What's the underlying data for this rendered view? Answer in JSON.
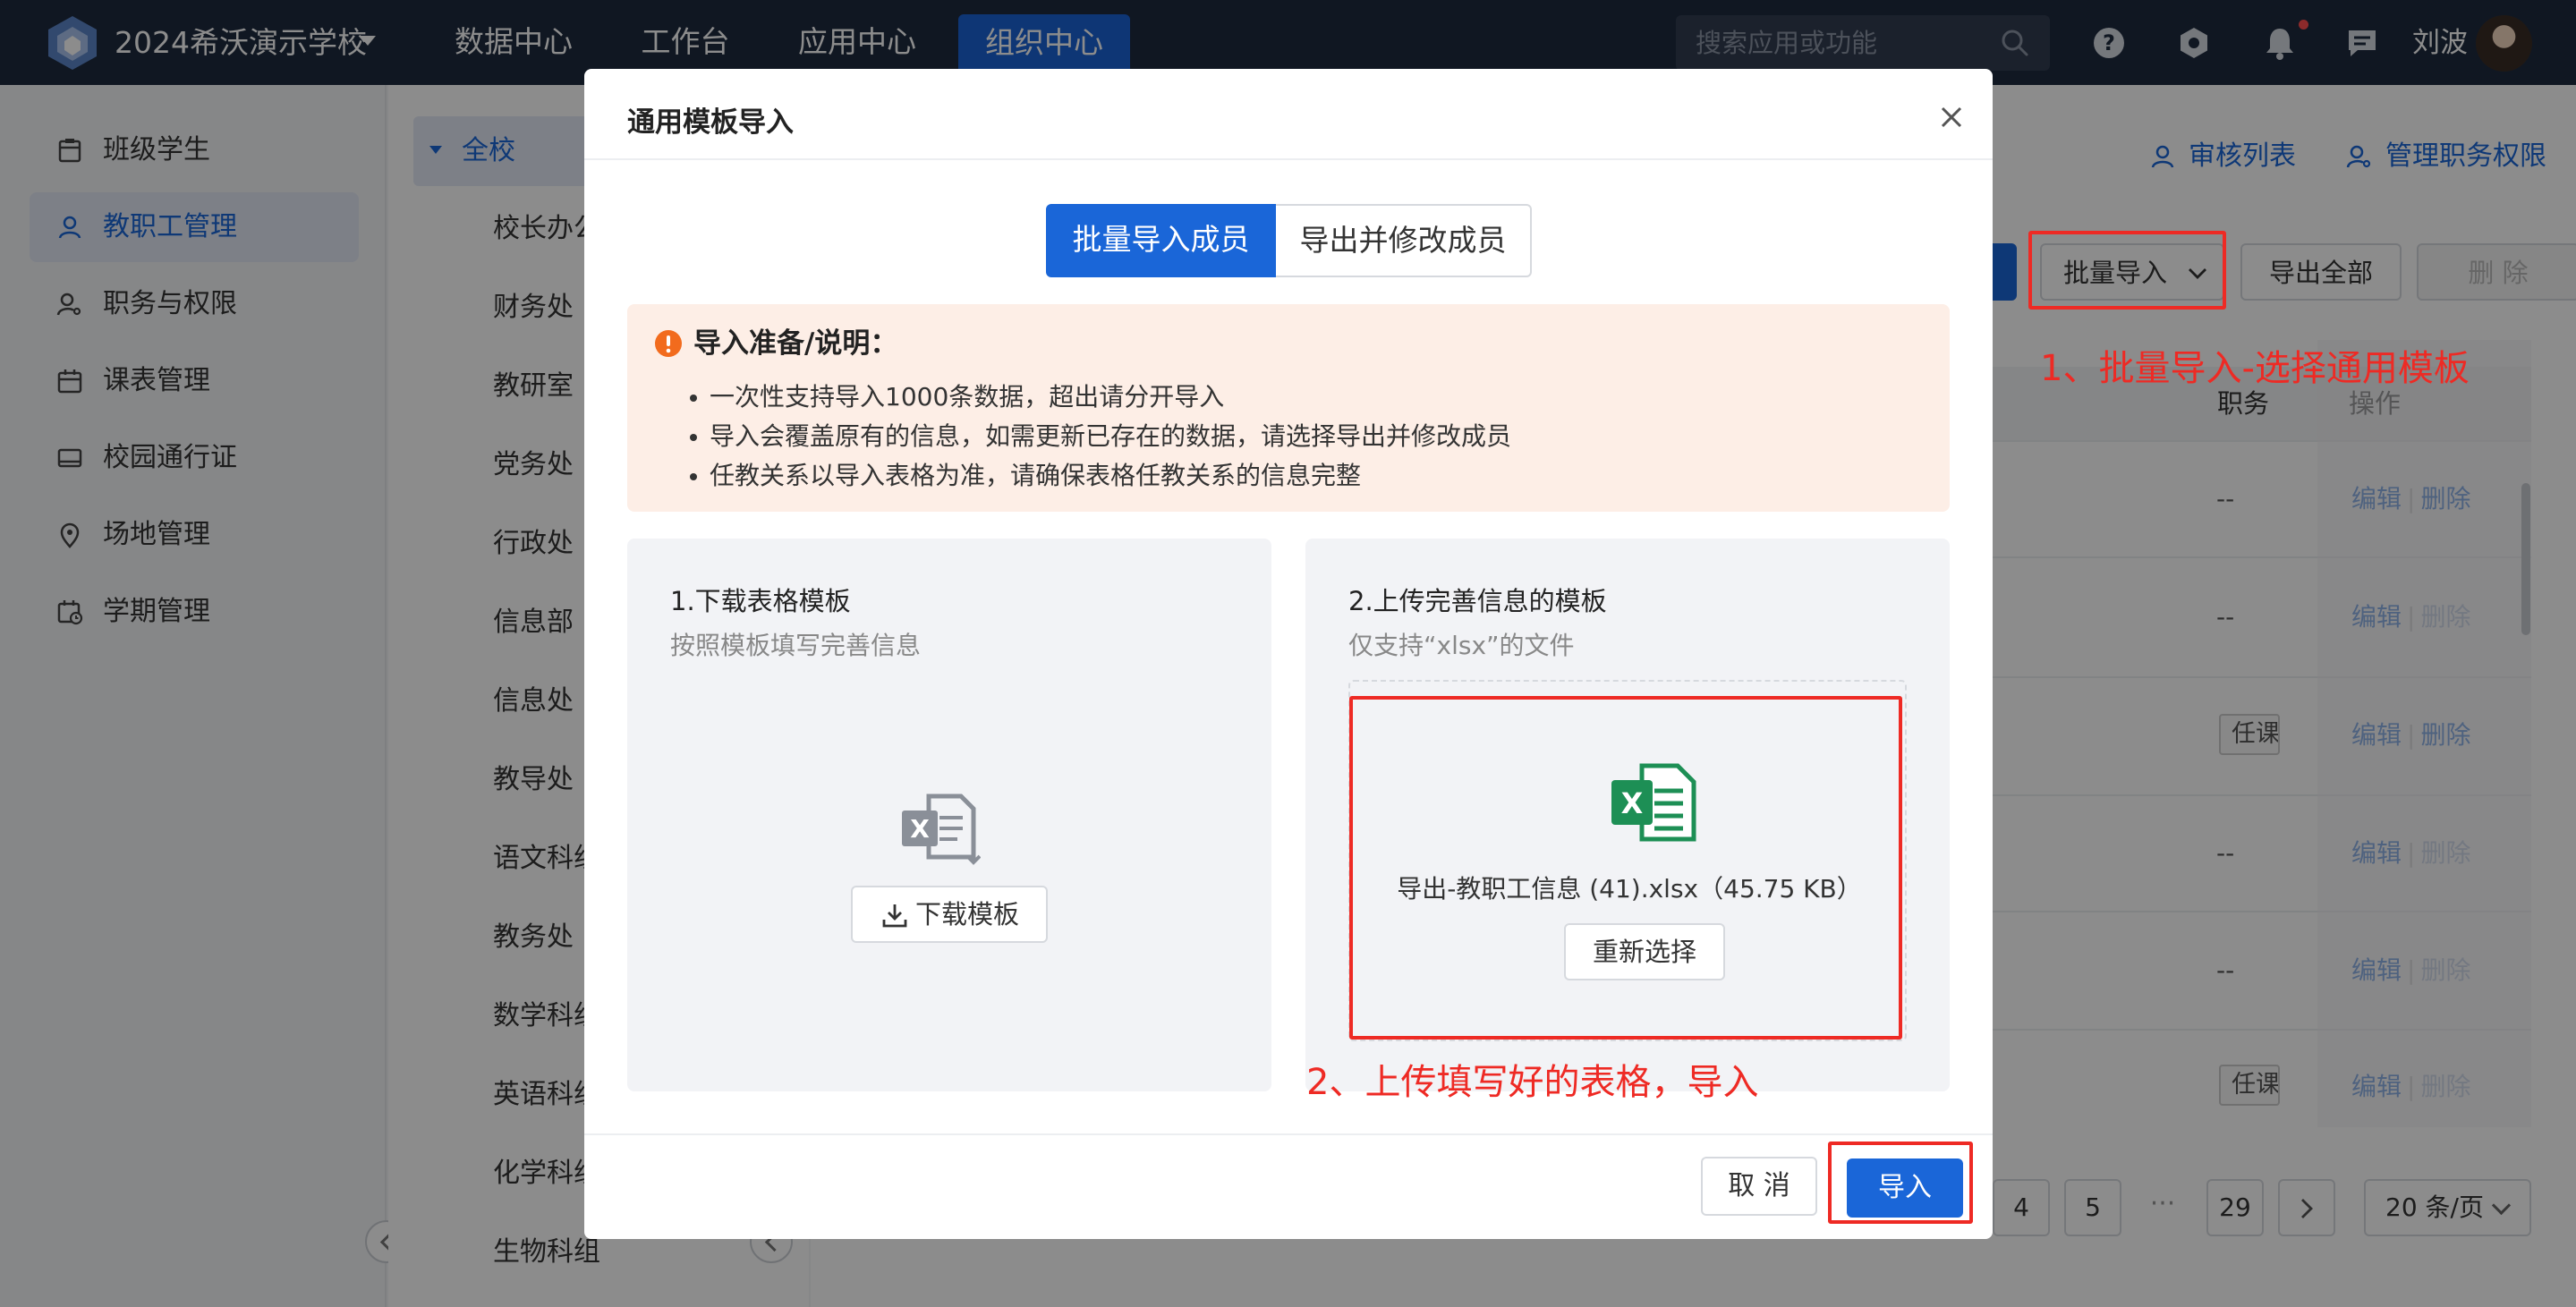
{
  "topbar": {
    "school_name": "2024希沃演示学校",
    "nav": [
      "数据中心",
      "工作台",
      "应用中心",
      "组织中心"
    ],
    "active_nav": "组织中心",
    "search_placeholder": "搜索应用或功能",
    "username": "刘波",
    "colors": {
      "bar": "#1e2a3f",
      "active": "#1b63d6"
    }
  },
  "sidebar": {
    "items": [
      {
        "label": "班级学生",
        "icon": "clipboard-icon"
      },
      {
        "label": "教职工管理",
        "icon": "user-icon",
        "active": true
      },
      {
        "label": "职务与权限",
        "icon": "user-key-icon"
      },
      {
        "label": "课表管理",
        "icon": "calendar-icon"
      },
      {
        "label": "校园通行证",
        "icon": "card-icon"
      },
      {
        "label": "场地管理",
        "icon": "location-pin-icon"
      },
      {
        "label": "学期管理",
        "icon": "calendar-clock-icon"
      }
    ]
  },
  "tree": {
    "root": "全校",
    "nodes": [
      "校长办公",
      "财务处",
      "教研室",
      "党务处",
      "行政处",
      "信息部",
      "信息处",
      "教导处",
      "语文科组",
      "教务处",
      "数学科组",
      "英语科组",
      "化学科组",
      "生物科组"
    ]
  },
  "main": {
    "links": {
      "review_list": "审核列表",
      "manage_duty": "管理职务权限"
    },
    "toolbar": {
      "batch_import": "批量导入",
      "export_all": "导出全部",
      "delete": "删 除"
    },
    "table_headers": {
      "duty": "职务",
      "operation": "操作"
    },
    "rows": [
      {
        "duty": "--",
        "edit": "编辑",
        "delete": "删除",
        "delete_enabled": true
      },
      {
        "duty": "--",
        "edit": "编辑",
        "delete": "删除",
        "delete_enabled": false
      },
      {
        "duty_tag": "任课老师",
        "edit": "编辑",
        "delete": "删除",
        "delete_enabled": true
      },
      {
        "duty": "--",
        "edit": "编辑",
        "delete": "删除",
        "delete_enabled": false
      },
      {
        "duty": "--",
        "edit": "编辑",
        "delete": "删除",
        "delete_enabled": false
      },
      {
        "duty_tag": "任课老师",
        "edit": "编辑",
        "delete": "删除",
        "delete_enabled": false
      }
    ],
    "pagination": {
      "pages": [
        "4",
        "5"
      ],
      "ellipsis": "···",
      "last": "29",
      "page_size": "20 条/页"
    }
  },
  "modal": {
    "title": "通用模板导入",
    "tabs": [
      "批量导入成员",
      "导出并修改成员"
    ],
    "notice": {
      "title": "导入准备/说明：",
      "items": [
        "一次性支持导入1000条数据，超出请分开导入",
        "导入会覆盖原有的信息，如需更新已存在的数据，请选择导出并修改成员",
        "任教关系以导入表格为准，请确保表格任教关系的信息完整"
      ]
    },
    "step1": {
      "title": "1.下载表格模板",
      "subtitle": "按照模板填写完善信息",
      "button": "下载模板"
    },
    "step2": {
      "title": "2.上传完善信息的模板",
      "subtitle": "仅支持“xlsx”的文件",
      "file_name": "导出-教职工信息 (41).xlsx（45.75 KB）",
      "reselect": "重新选择"
    },
    "footer": {
      "cancel": "取 消",
      "import": "导入"
    }
  },
  "annotations": {
    "step1": "1、批量导入-选择通用模板",
    "step2": "2、上传填写好的表格，导入",
    "color": "#ee2a24"
  }
}
